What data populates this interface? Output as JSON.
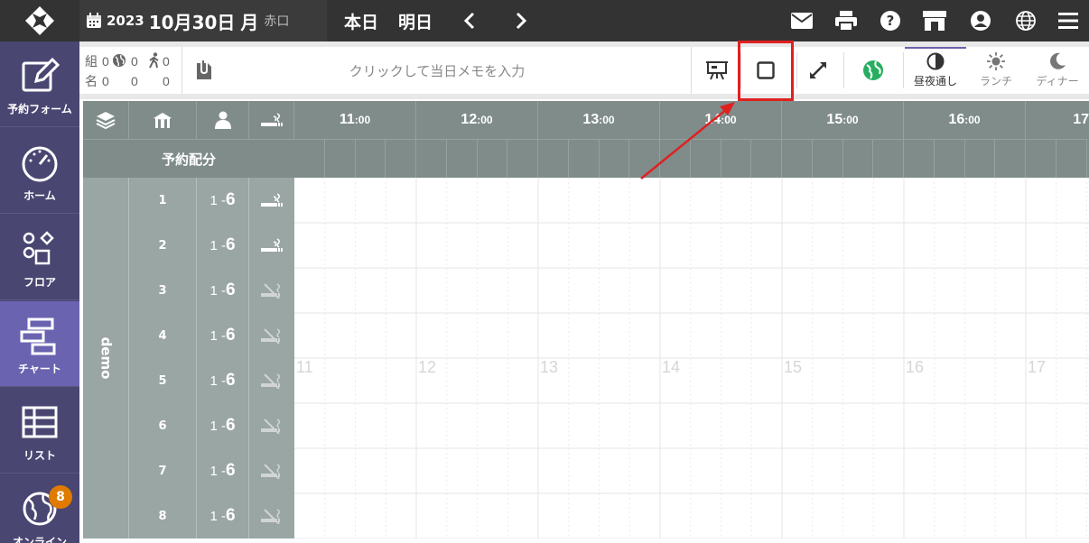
{
  "header": {
    "year": "2023",
    "month_day": "10月30日",
    "weekday": "月",
    "rokuyo": "赤口",
    "today_label": "本日",
    "tomorrow_label": "明日",
    "icons": [
      "mail-icon",
      "print-icon",
      "help-icon",
      "store-icon",
      "user-icon",
      "globe-icon",
      "menu-icon"
    ]
  },
  "sidebar": {
    "items": [
      {
        "label": "予約フォーム",
        "icon": "form-edit-icon"
      },
      {
        "label": "ホーム",
        "icon": "dashboard-gauge-icon"
      },
      {
        "label": "フロア",
        "icon": "floor-shapes-icon"
      },
      {
        "label": "チャート",
        "icon": "chart-timeline-icon"
      },
      {
        "label": "リスト",
        "icon": "list-table-icon"
      },
      {
        "label": "オンライン",
        "icon": "online-globe-icon",
        "badge": "8"
      }
    ],
    "active_index": 3
  },
  "toolbar": {
    "groups_label": "組",
    "people_label": "名",
    "groups_total": "0",
    "groups_web": "0",
    "groups_walkin": "0",
    "people_total": "0",
    "people_web": "0",
    "people_walkin": "0",
    "memo_placeholder": "クリックして当日メモを入力",
    "modes": [
      {
        "label": "昼夜通し",
        "icon": "half-circle-icon"
      },
      {
        "label": "ランチ",
        "icon": "sun-icon"
      },
      {
        "label": "ディナー",
        "icon": "moon-icon"
      }
    ]
  },
  "chart_header": {
    "hours": [
      {
        "h": "11",
        "m": ":00"
      },
      {
        "h": "12",
        "m": ":00"
      },
      {
        "h": "13",
        "m": ":00"
      },
      {
        "h": "14",
        "m": ":00"
      },
      {
        "h": "15",
        "m": ":00"
      },
      {
        "h": "16",
        "m": ":00"
      },
      {
        "h": "17",
        "m": ""
      }
    ],
    "alloc_label": "予約配分",
    "group_name": "demo"
  },
  "tables": [
    {
      "num": "1",
      "min": "1 - ",
      "max": "6",
      "smoking": true
    },
    {
      "num": "2",
      "min": "1 - ",
      "max": "6",
      "smoking": true
    },
    {
      "num": "3",
      "min": "1 - ",
      "max": "6",
      "smoking": false
    },
    {
      "num": "4",
      "min": "1 - ",
      "max": "6",
      "smoking": false
    },
    {
      "num": "5",
      "min": "1 - ",
      "max": "6",
      "smoking": false
    },
    {
      "num": "6",
      "min": "1 - ",
      "max": "6",
      "smoking": false
    },
    {
      "num": "7",
      "min": "1 - ",
      "max": "6",
      "smoking": false
    },
    {
      "num": "8",
      "min": "1 - ",
      "max": "6",
      "smoking": false
    }
  ],
  "grid_watermarks": [
    "11",
    "12",
    "13",
    "14",
    "15",
    "16",
    "17"
  ],
  "colors": {
    "topbar": "#333333",
    "sidebar": "#4a4672",
    "sidebar_active": "#6a63b0",
    "chart_header": "#7f8c8a",
    "table_cells": "#9aa6a4",
    "highlight": "#e02020",
    "badge": "#e07b00"
  }
}
